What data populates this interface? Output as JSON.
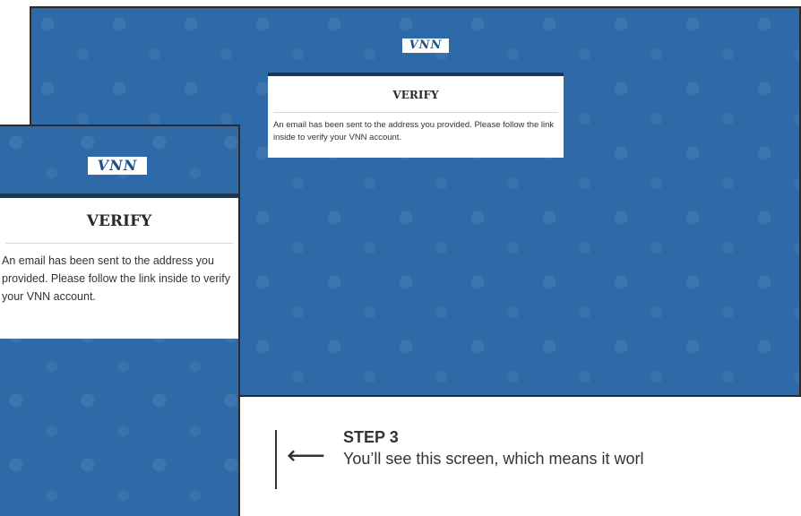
{
  "desktop": {
    "logo": "VNN",
    "card": {
      "title": "VERIFY",
      "body": "An email has been sent to the address you provided. Please follow the link inside to verify your VNN account."
    }
  },
  "mobile": {
    "logo": "VNN",
    "card": {
      "title": "VERIFY",
      "body": "An email has been sent to the address you provided. Please follow the link inside to verify your VNN account."
    }
  },
  "step": {
    "title": "STEP 3",
    "text": "You’ll see this screen, which means it worl",
    "arrow_icon": "left-arrow"
  },
  "colors": {
    "background": "#2f6aa8",
    "card_top_border": "#1f3552",
    "logo_text": "#1f4f86"
  }
}
